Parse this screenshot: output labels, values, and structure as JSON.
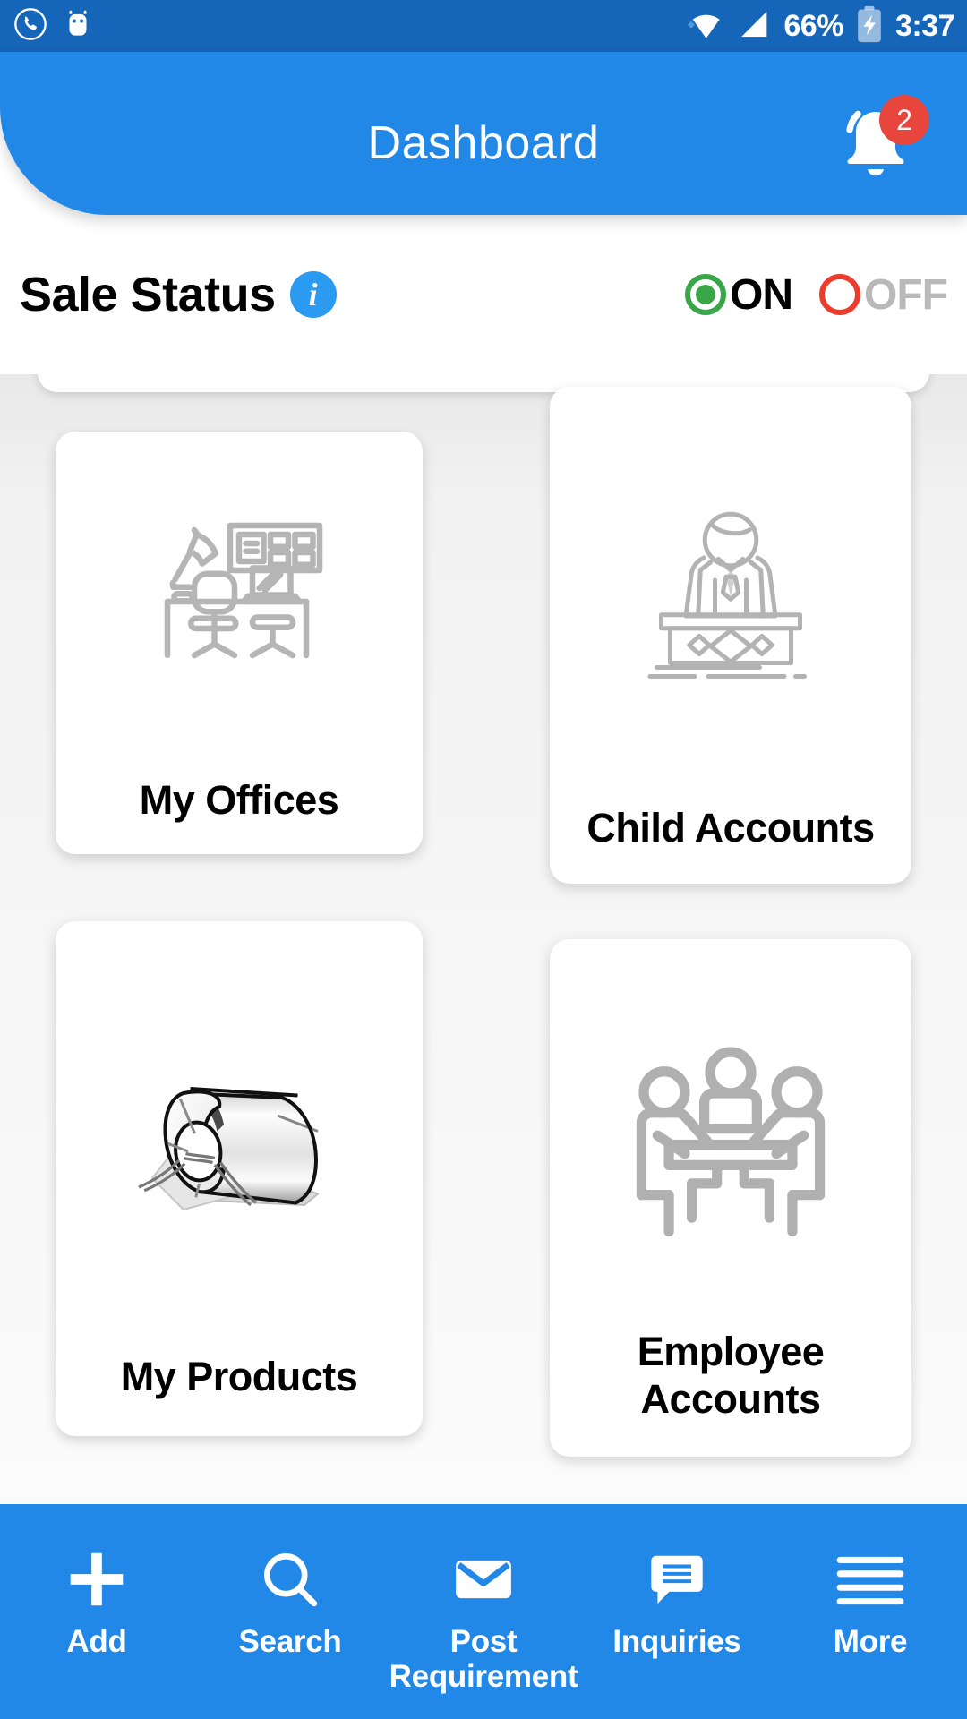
{
  "status_bar": {
    "icons": [
      "phone-call-icon",
      "android-robot-icon",
      "wifi-icon",
      "cell-signal-icon",
      "battery-charging-icon"
    ],
    "battery": "66%",
    "time": "3:37"
  },
  "header": {
    "title": "Dashboard",
    "notification_icon": "bell-icon",
    "notification_count": "2",
    "background_color": "#2288e8",
    "badge_color": "#e8453c"
  },
  "sale_status": {
    "label": "Sale Status",
    "info_icon": "info-icon",
    "info_glyph": "i",
    "options": [
      {
        "label": "ON",
        "selected": true,
        "color": "#3aa64a"
      },
      {
        "label": "OFF",
        "selected": false,
        "color": "#ef3b2d"
      }
    ]
  },
  "dashboard_cards": [
    {
      "label": "My Offices",
      "icon": "office-desk-icon"
    },
    {
      "label": "Child Accounts",
      "icon": "reception-person-icon"
    },
    {
      "label": "My Products",
      "icon": "steel-coil-icon"
    },
    {
      "label": "Employee Accounts",
      "icon": "meeting-people-icon"
    }
  ],
  "bottom_nav": [
    {
      "label": "Add",
      "icon": "plus-icon"
    },
    {
      "label": "Search",
      "icon": "search-icon"
    },
    {
      "label": "Post Requirement",
      "icon": "envelope-icon"
    },
    {
      "label": "Inquiries",
      "icon": "chat-bubble-icon"
    },
    {
      "label": "More",
      "icon": "hamburger-menu-icon"
    }
  ]
}
